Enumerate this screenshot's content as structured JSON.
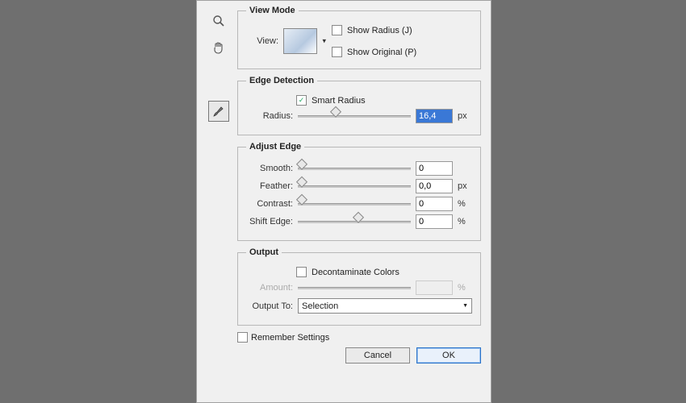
{
  "tools": {
    "magnify": "magnify-icon",
    "hand": "hand-icon",
    "brush": "brush-icon"
  },
  "viewMode": {
    "legend": "View Mode",
    "viewLabel": "View:",
    "showRadius": "Show Radius (J)",
    "showOriginal": "Show Original (P)",
    "showRadiusChecked": false,
    "showOriginalChecked": false
  },
  "edgeDetection": {
    "legend": "Edge Detection",
    "smartRadius": "Smart Radius",
    "smartRadiusChecked": true,
    "radiusLabel": "Radius:",
    "radiusValue": "16,4",
    "radiusUnit": "px",
    "radiusSliderPos": 30
  },
  "adjustEdge": {
    "legend": "Adjust Edge",
    "smoothLabel": "Smooth:",
    "smoothValue": "0",
    "featherLabel": "Feather:",
    "featherValue": "0,0",
    "featherUnit": "px",
    "contrastLabel": "Contrast:",
    "contrastValue": "0",
    "contrastUnit": "%",
    "shiftLabel": "Shift Edge:",
    "shiftValue": "0",
    "shiftUnit": "%",
    "smoothPos": 0,
    "featherPos": 0,
    "contrastPos": 0,
    "shiftPos": 50
  },
  "output": {
    "legend": "Output",
    "decon": "Decontaminate Colors",
    "deconChecked": false,
    "amountLabel": "Amount:",
    "amountValue": "",
    "amountUnit": "%",
    "outputToLabel": "Output To:",
    "outputToValue": "Selection"
  },
  "remember": "Remember Settings",
  "rememberChecked": false,
  "buttons": {
    "cancel": "Cancel",
    "ok": "OK"
  }
}
